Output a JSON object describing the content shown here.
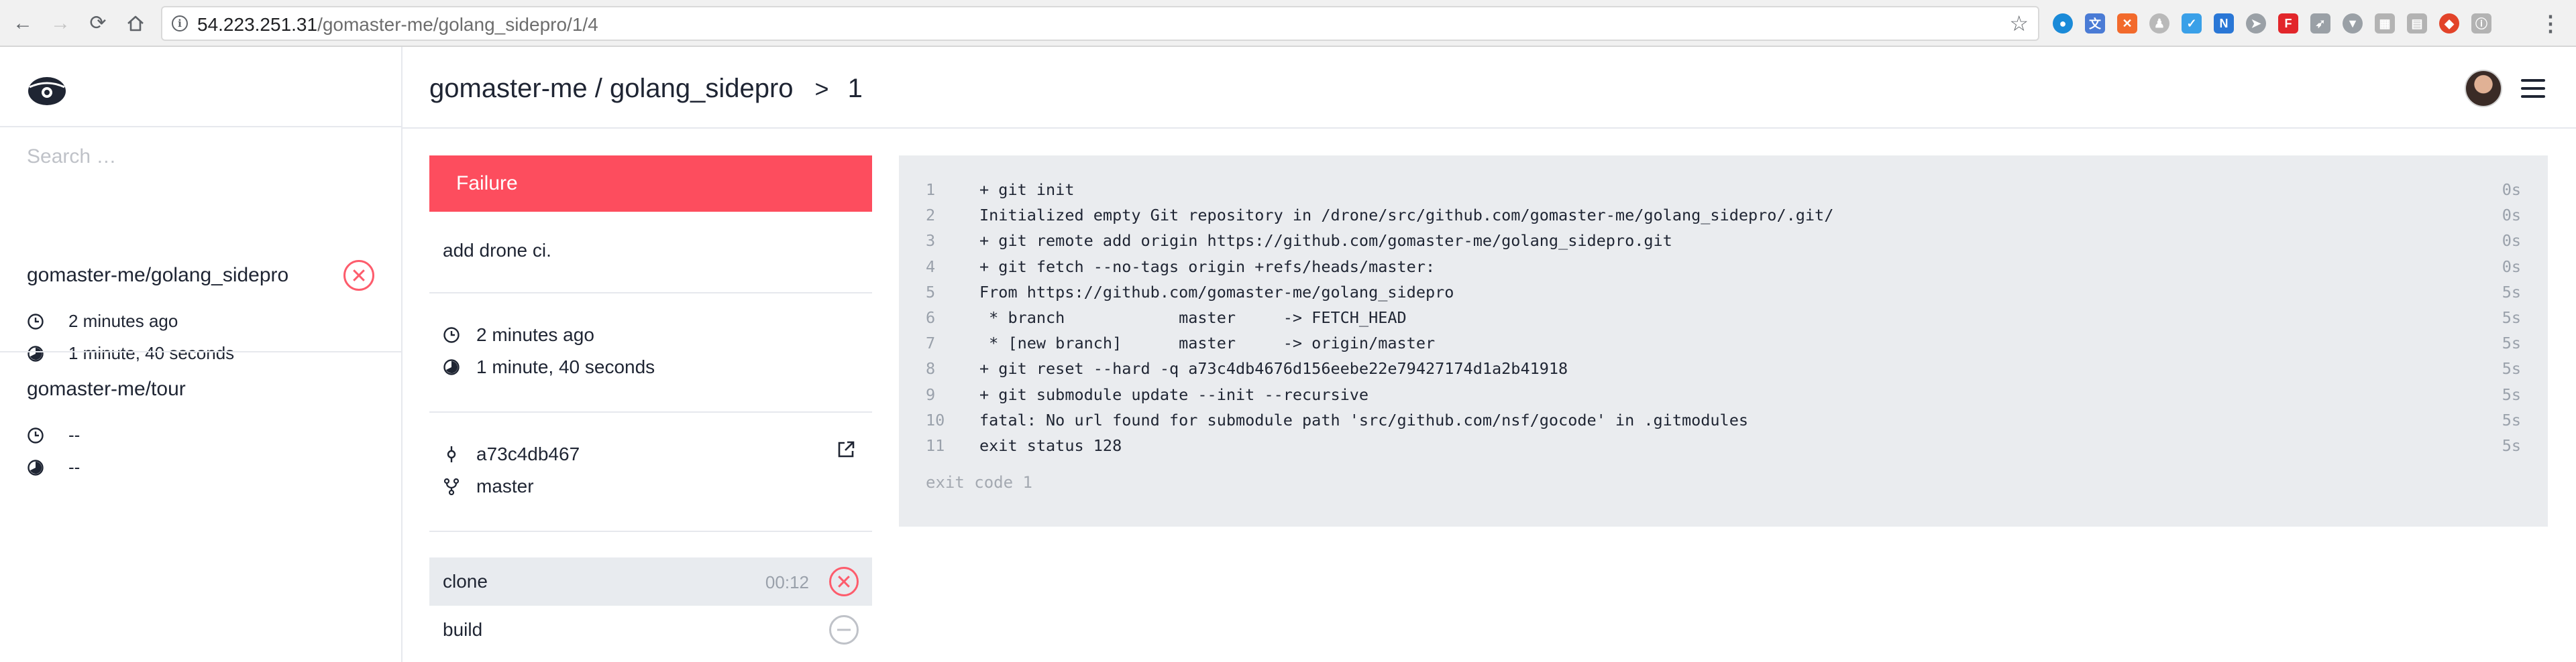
{
  "browser": {
    "url_host": "54.223.251.31",
    "url_path": "/gomaster-me/golang_sidepro/1/4",
    "extensions": [
      {
        "name": "ext-blue-circle-icon",
        "color": "#1a8ad8",
        "glyph": "●"
      },
      {
        "name": "translate-icon",
        "color": "#4a7bd5",
        "glyph": "文"
      },
      {
        "name": "ext-orange-icon",
        "color": "#f26a2c",
        "glyph": "✕"
      },
      {
        "name": "ext-person-icon",
        "color": "#b9b9b9",
        "glyph": "♟"
      },
      {
        "name": "ext-check-icon",
        "color": "#3aa0e8",
        "glyph": "✓"
      },
      {
        "name": "ext-new-icon",
        "color": "#2a77d6",
        "glyph": "N"
      },
      {
        "name": "ext-grey-arrow-icon",
        "color": "#9aa0a6",
        "glyph": "➤"
      },
      {
        "name": "ext-pdf-icon",
        "color": "#e2262b",
        "glyph": "F"
      },
      {
        "name": "ext-send-icon",
        "color": "#9aa0a6",
        "glyph": "➶"
      },
      {
        "name": "ext-vue-icon",
        "color": "#9aa0a6",
        "glyph": "▼"
      },
      {
        "name": "ext-grid-icon",
        "color": "#b3b3b3",
        "glyph": "▦"
      },
      {
        "name": "ext-table-icon",
        "color": "#b3b3b3",
        "glyph": "▤"
      },
      {
        "name": "gitlab-icon",
        "color": "#e24329",
        "glyph": "◆"
      },
      {
        "name": "ext-info-icon",
        "color": "#b3b3b3",
        "glyph": "ⓘ"
      }
    ]
  },
  "sidebar": {
    "search_placeholder": "Search …",
    "repos": [
      {
        "name": "gomaster-me/golang_sidepro",
        "started": "2 minutes ago",
        "duration": "1 minute, 40 seconds",
        "status": "failure"
      },
      {
        "name": "gomaster-me/tour",
        "started": "--",
        "duration": "--",
        "status": "none"
      }
    ]
  },
  "header": {
    "owner_repo": "gomaster-me / golang_sidepro",
    "separator": ">",
    "build_number": "1"
  },
  "build": {
    "status_label": "Failure",
    "commit_message": "add drone ci.",
    "started": "2 minutes ago",
    "duration": "1 minute, 40 seconds",
    "commit_sha": "a73c4db467",
    "branch": "master",
    "steps": [
      {
        "name": "clone",
        "time": "00:12",
        "status": "failure"
      },
      {
        "name": "build",
        "time": "",
        "status": "skipped"
      }
    ]
  },
  "log": {
    "lines": [
      {
        "n": "1",
        "text": "+ git init",
        "t": "0s"
      },
      {
        "n": "2",
        "text": "Initialized empty Git repository in /drone/src/github.com/gomaster-me/golang_sidepro/.git/",
        "t": "0s"
      },
      {
        "n": "3",
        "text": "+ git remote add origin https://github.com/gomaster-me/golang_sidepro.git",
        "t": "0s"
      },
      {
        "n": "4",
        "text": "+ git fetch --no-tags origin +refs/heads/master:",
        "t": "0s"
      },
      {
        "n": "5",
        "text": "From https://github.com/gomaster-me/golang_sidepro",
        "t": "5s"
      },
      {
        "n": "6",
        "text": " * branch            master     -> FETCH_HEAD",
        "t": "5s"
      },
      {
        "n": "7",
        "text": " * [new branch]      master     -> origin/master",
        "t": "5s"
      },
      {
        "n": "8",
        "text": "+ git reset --hard -q a73c4db4676d156eebe22e79427174d1a2b41918",
        "t": "5s"
      },
      {
        "n": "9",
        "text": "+ git submodule update --init --recursive",
        "t": "5s"
      },
      {
        "n": "10",
        "text": "fatal: No url found for submodule path 'src/github.com/nsf/gocode' in .gitmodules",
        "t": "5s"
      },
      {
        "n": "11",
        "text": "exit status 128",
        "t": "5s"
      }
    ],
    "exit_code": "exit code 1"
  },
  "colors": {
    "failure": "#fd4d5e",
    "log_bg": "#eaecef",
    "muted": "#9aa1ab"
  }
}
